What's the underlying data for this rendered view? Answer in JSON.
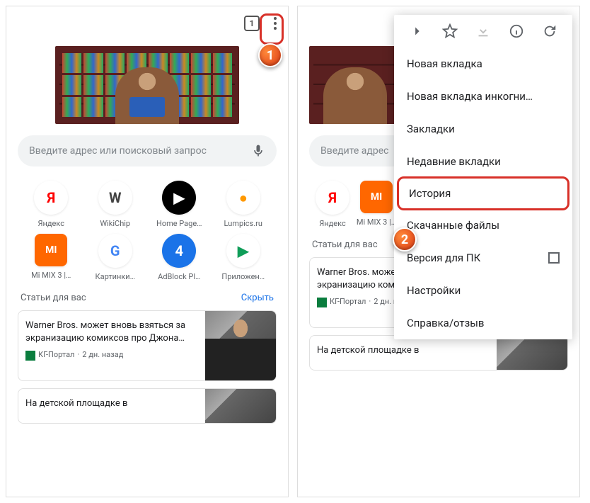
{
  "topbar": {
    "tab_count": "1"
  },
  "search": {
    "placeholder": "Введите адрес или поисковый запрос"
  },
  "tiles": [
    {
      "label": "Яндекс",
      "bg": "#ffffff",
      "fg": "#ff0000",
      "glyph": "Я"
    },
    {
      "label": "WikiChip",
      "bg": "#ffffff",
      "fg": "#444444",
      "glyph": "W"
    },
    {
      "label": "Home Page…",
      "bg": "#000000",
      "fg": "#ffffff",
      "glyph": "▶"
    },
    {
      "label": "Lumpics.ru",
      "bg": "#ffffff",
      "fg": "#ff9800",
      "glyph": "●"
    },
    {
      "label": "Mi MIX 3 |…",
      "bg": "#ff6700",
      "fg": "#ffffff",
      "glyph": "MI",
      "square": true
    },
    {
      "label": "Картинки…",
      "bg": "#ffffff",
      "fg": "#4285f4",
      "glyph": "G"
    },
    {
      "label": "AdBlock Pl…",
      "bg": "#1a73e8",
      "fg": "#ffffff",
      "glyph": "4"
    },
    {
      "label": "Приложен…",
      "bg": "#ffffff",
      "fg": "#0f9d58",
      "glyph": "▶"
    }
  ],
  "section": {
    "title": "Статьи для вас",
    "hide": "Скрыть"
  },
  "cards": [
    {
      "title": "Warner Bros. может вновь взяться за экранизацию комиксов про Джона…",
      "source": "КГ-Портал",
      "time": "2 дн. назад"
    },
    {
      "title": "На детской площадке в"
    }
  ],
  "menu": {
    "items": [
      "Новая вкладка",
      "Новая вкладка инкогни…",
      "Закладки",
      "Недавние вкладки",
      "История",
      "Скачанные файлы",
      "Версия для ПК",
      "Настройки",
      "Справка/отзыв"
    ],
    "highlighted_index": 4
  },
  "callouts": {
    "one": "1",
    "two": "2"
  }
}
